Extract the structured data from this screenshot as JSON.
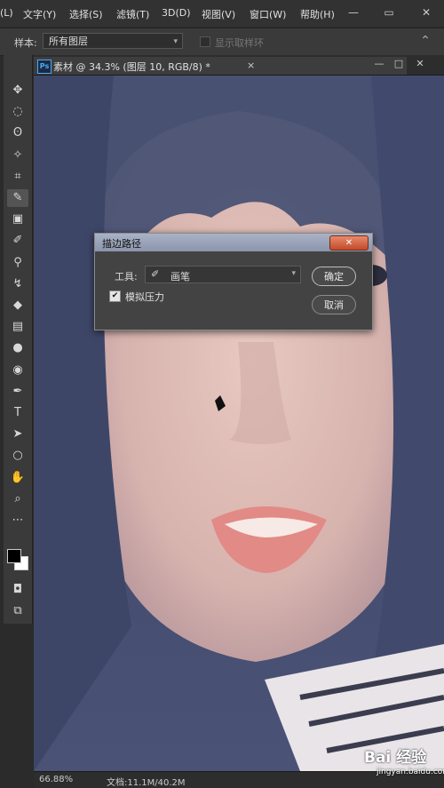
{
  "menubar": {
    "items": [
      "(L)",
      "文字(Y)",
      "选择(S)",
      "滤镜(T)",
      "3D(D)",
      "视图(V)",
      "窗口(W)",
      "帮助(H)"
    ],
    "window_controls": [
      "—",
      "▭",
      "✕"
    ]
  },
  "options_bar": {
    "sample_label": "样本:",
    "sample_value": "所有图层",
    "ring_label": "显示取样环"
  },
  "document": {
    "title": "素材 @ 34.3% (图层 10, RGB/8) *",
    "close": "×",
    "tab_icon": "Ps"
  },
  "toolbar": {
    "tools": [
      {
        "name": "move-tool-icon",
        "glyph": "✥"
      },
      {
        "name": "marquee-tool-icon",
        "glyph": "◌"
      },
      {
        "name": "lasso-tool-icon",
        "glyph": "ʘ"
      },
      {
        "name": "magic-wand-tool-icon",
        "glyph": "✧"
      },
      {
        "name": "crop-tool-icon",
        "glyph": "⌗"
      },
      {
        "name": "eyedropper-tool-icon",
        "glyph": "✎"
      },
      {
        "name": "healing-brush-tool-icon",
        "glyph": "▣"
      },
      {
        "name": "brush-tool-icon",
        "glyph": "✐"
      },
      {
        "name": "clone-stamp-tool-icon",
        "glyph": "⚲"
      },
      {
        "name": "history-brush-tool-icon",
        "glyph": "↯"
      },
      {
        "name": "eraser-tool-icon",
        "glyph": "◆"
      },
      {
        "name": "gradient-tool-icon",
        "glyph": "▤"
      },
      {
        "name": "blur-tool-icon",
        "glyph": "●"
      },
      {
        "name": "dodge-tool-icon",
        "glyph": "◉"
      },
      {
        "name": "pen-tool-icon",
        "glyph": "✒"
      },
      {
        "name": "type-tool-icon",
        "glyph": "T"
      },
      {
        "name": "path-selection-tool-icon",
        "glyph": "➤"
      },
      {
        "name": "ellipse-tool-icon",
        "glyph": "○"
      },
      {
        "name": "hand-tool-icon",
        "glyph": "✋"
      },
      {
        "name": "zoom-tool-icon",
        "glyph": "⌕"
      },
      {
        "name": "more-tools-icon",
        "glyph": "⋯"
      }
    ]
  },
  "dialog": {
    "title": "描边路径",
    "close": "✕",
    "tool_label": "工具:",
    "tool_value": "画笔",
    "pressure_label": "模拟压力",
    "pressure_checked": true,
    "ok_label": "确定",
    "cancel_label": "取消"
  },
  "statusbar": {
    "zoom": "66.88%",
    "doc_size": "文档:11.1M/40.2M"
  },
  "watermark": {
    "logo": "Bai 经验",
    "url": "jingyan.baidu.com"
  }
}
